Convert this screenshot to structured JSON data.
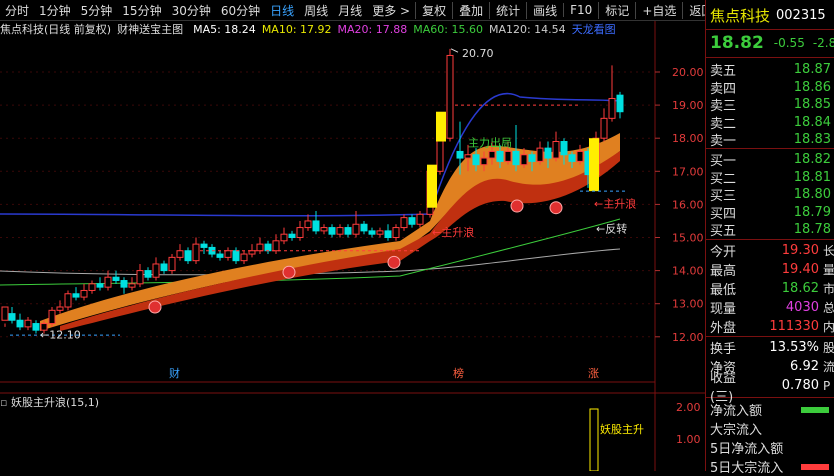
{
  "toolbar": {
    "periods": [
      "分时",
      "1分钟",
      "5分钟",
      "15分钟",
      "30分钟",
      "60分钟",
      "日线",
      "周线",
      "月线",
      "更多 >"
    ],
    "active_period": "日线",
    "buttons": [
      "复权",
      "叠加",
      "统计",
      "画线",
      "F10",
      "标记",
      "+自选",
      "返回"
    ]
  },
  "chart": {
    "title": "焦点科技(日线 前复权)",
    "indicator_name": "财神送宝主图",
    "ma": [
      {
        "label": "MA5: 18.24",
        "color": "#ffffff"
      },
      {
        "label": "MA10: 17.92",
        "color": "#e8e800"
      },
      {
        "label": "MA20: 17.88",
        "color": "#e040e0"
      },
      {
        "label": "MA60: 15.60",
        "color": "#3ccc3c"
      },
      {
        "label": "MA120: 14.54",
        "color": "#cccccc"
      }
    ],
    "extra_label": "天龙看图",
    "y_ticks": [
      "20.00",
      "19.00",
      "18.00",
      "17.00",
      "16.00",
      "15.00",
      "14.00",
      "13.00",
      "12.00"
    ],
    "annotations": {
      "high": "20.70",
      "low": "←12.10",
      "main_up_1": "←主升浪",
      "main_up_2": "←主升浪",
      "reversal": "←反转",
      "exit": "主力出局"
    },
    "markers": [
      "财",
      "榜",
      "涨"
    ],
    "colors": {
      "up": "#ff3c3c",
      "down": "#00e0e0",
      "ribbon_dark": "#c03010",
      "ribbon_light": "#e08020"
    }
  },
  "sub_chart": {
    "title": "妖股主升浪(15,1)",
    "y_ticks": [
      "2.00",
      "1.00"
    ],
    "signal_label": "妖股主升"
  },
  "right_panel": {
    "stock_name": "焦点科技",
    "stock_code": "002315",
    "price": "18.82",
    "change": "-0.55",
    "change_pct": "-2.8",
    "asks": [
      {
        "label": "卖五",
        "price": "18.87"
      },
      {
        "label": "卖四",
        "price": "18.86"
      },
      {
        "label": "卖三",
        "price": "18.85"
      },
      {
        "label": "卖二",
        "price": "18.84"
      },
      {
        "label": "卖一",
        "price": "18.83"
      }
    ],
    "bids": [
      {
        "label": "买一",
        "price": "18.82"
      },
      {
        "label": "买二",
        "price": "18.81"
      },
      {
        "label": "买三",
        "price": "18.80"
      },
      {
        "label": "买四",
        "price": "18.79"
      },
      {
        "label": "买五",
        "price": "18.78"
      }
    ],
    "stats": [
      {
        "label": "今开",
        "value": "19.30",
        "suffix": "长"
      },
      {
        "label": "最高",
        "value": "19.40",
        "suffix": "量"
      },
      {
        "label": "最低",
        "value": "18.62",
        "suffix": "市"
      },
      {
        "label": "现量",
        "value": "4030",
        "suffix": "总"
      },
      {
        "label": "外盘",
        "value": "111330",
        "suffix": "内"
      }
    ],
    "stats2": [
      {
        "label": "换手",
        "value": "13.53%",
        "suffix": "股"
      },
      {
        "label": "净资",
        "value": "6.92",
        "suffix": "流"
      },
      {
        "label": "收益(三)",
        "value": "0.780",
        "suffix": "P"
      }
    ],
    "flows": [
      "净流入额",
      "大宗流入",
      "5日净流入额",
      "5日大宗流入"
    ]
  }
}
